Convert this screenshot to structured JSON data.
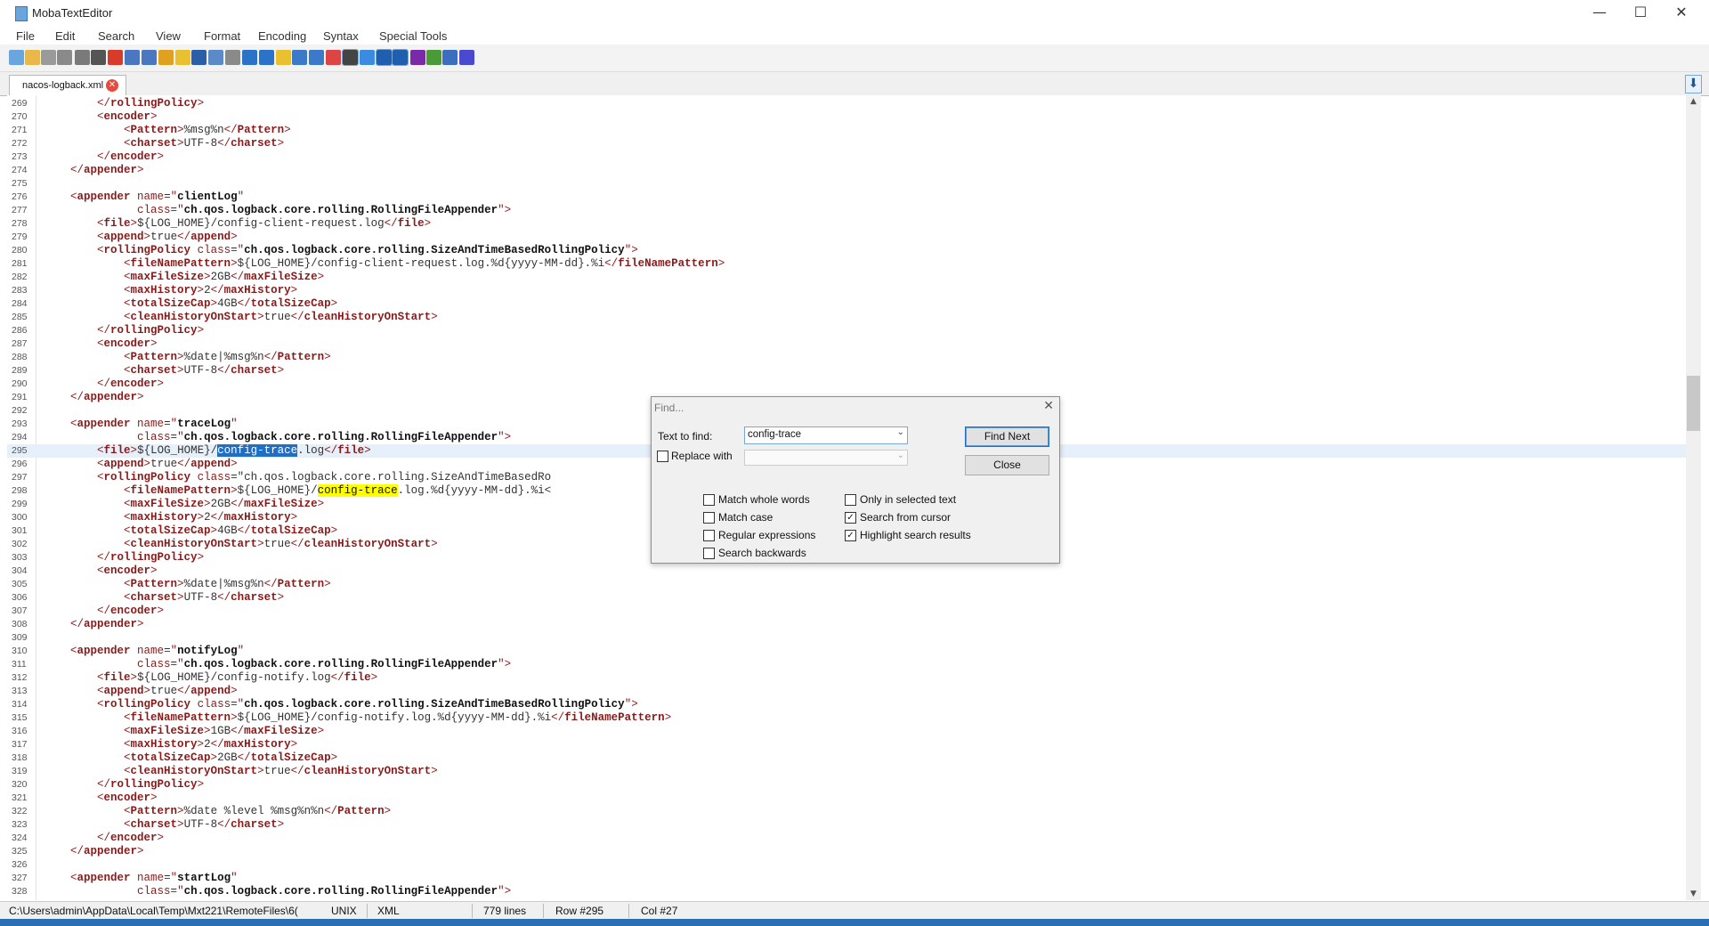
{
  "window": {
    "title": "MobaTextEditor",
    "minimize": "—",
    "maximize": "☐",
    "close": "✕"
  },
  "menu": [
    "File",
    "Edit",
    "Search",
    "View",
    "Format",
    "Encoding",
    "Syntax",
    "Special Tools"
  ],
  "toolbar_icons": [
    "new-file-icon",
    "open-folder-icon",
    "reload-icon",
    "save-icon",
    "save-all-icon",
    "print-icon",
    "close-file-icon",
    "indent-icon",
    "unindent-icon",
    "bookmark-icon",
    "favorite-icon",
    "cut-icon",
    "copy-icon",
    "paste-icon",
    "find-icon",
    "find-replace-icon",
    "mark-icon",
    "window-icon",
    "split-icon",
    "windows-icon",
    "linux-icon",
    "apple-icon",
    "undo-icon",
    "column-icon",
    "pilcrow-icon",
    "highlighter-icon",
    "settings-icon",
    "close-all-icon"
  ],
  "tab": {
    "label": "nacos-logback.xml",
    "close": "✕",
    "nav": "⬇"
  },
  "colors": {
    "tag": "#8a1a1a",
    "selection": "#1f6fc8",
    "highlight": "#ffff00",
    "current_line": "#e6f0fb"
  },
  "editor": {
    "current_line": 295,
    "lines": [
      {
        "n": "269",
        "t": "        </rollingPolicy>"
      },
      {
        "n": "270",
        "t": "        <encoder>"
      },
      {
        "n": "271",
        "t": "            <Pattern>%msg%n</Pattern>"
      },
      {
        "n": "272",
        "t": "            <charset>UTF-8</charset>"
      },
      {
        "n": "273",
        "t": "        </encoder>"
      },
      {
        "n": "274",
        "t": "    </appender>"
      },
      {
        "n": "275",
        "t": ""
      },
      {
        "n": "276",
        "t": "    <appender name=\"clientLog\""
      },
      {
        "n": "277",
        "t": "              class=\"ch.qos.logback.core.rolling.RollingFileAppender\">"
      },
      {
        "n": "278",
        "t": "        <file>${LOG_HOME}/config-client-request.log</file>"
      },
      {
        "n": "279",
        "t": "        <append>true</append>"
      },
      {
        "n": "280",
        "t": "        <rollingPolicy class=\"ch.qos.logback.core.rolling.SizeAndTimeBasedRollingPolicy\">"
      },
      {
        "n": "281",
        "t": "            <fileNamePattern>${LOG_HOME}/config-client-request.log.%d{yyyy-MM-dd}.%i</fileNamePattern>"
      },
      {
        "n": "282",
        "t": "            <maxFileSize>2GB</maxFileSize>"
      },
      {
        "n": "283",
        "t": "            <maxHistory>2</maxHistory>"
      },
      {
        "n": "284",
        "t": "            <totalSizeCap>4GB</totalSizeCap>"
      },
      {
        "n": "285",
        "t": "            <cleanHistoryOnStart>true</cleanHistoryOnStart>"
      },
      {
        "n": "286",
        "t": "        </rollingPolicy>"
      },
      {
        "n": "287",
        "t": "        <encoder>"
      },
      {
        "n": "288",
        "t": "            <Pattern>%date|%msg%n</Pattern>"
      },
      {
        "n": "289",
        "t": "            <charset>UTF-8</charset>"
      },
      {
        "n": "290",
        "t": "        </encoder>"
      },
      {
        "n": "291",
        "t": "    </appender>"
      },
      {
        "n": "292",
        "t": ""
      },
      {
        "n": "293",
        "t": "    <appender name=\"traceLog\""
      },
      {
        "n": "294",
        "t": "              class=\"ch.qos.logback.core.rolling.RollingFileAppender\">"
      },
      {
        "n": "295",
        "t": "        <file>${LOG_HOME}/config-trace.log</file>",
        "sel": "config-trace"
      },
      {
        "n": "296",
        "t": "        <append>true</append>"
      },
      {
        "n": "297",
        "t": "        <rollingPolicy class=\"ch.qos.logback.core.rolling.SizeAndTimeBasedRo"
      },
      {
        "n": "298",
        "t": "            <fileNamePattern>${LOG_HOME}/config-trace.log.%d{yyyy-MM-dd}.%i<",
        "hl": "config-trace"
      },
      {
        "n": "299",
        "t": "            <maxFileSize>2GB</maxFileSize>"
      },
      {
        "n": "300",
        "t": "            <maxHistory>2</maxHistory>"
      },
      {
        "n": "301",
        "t": "            <totalSizeCap>4GB</totalSizeCap>"
      },
      {
        "n": "302",
        "t": "            <cleanHistoryOnStart>true</cleanHistoryOnStart>"
      },
      {
        "n": "303",
        "t": "        </rollingPolicy>"
      },
      {
        "n": "304",
        "t": "        <encoder>"
      },
      {
        "n": "305",
        "t": "            <Pattern>%date|%msg%n</Pattern>"
      },
      {
        "n": "306",
        "t": "            <charset>UTF-8</charset>"
      },
      {
        "n": "307",
        "t": "        </encoder>"
      },
      {
        "n": "308",
        "t": "    </appender>"
      },
      {
        "n": "309",
        "t": ""
      },
      {
        "n": "310",
        "t": "    <appender name=\"notifyLog\""
      },
      {
        "n": "311",
        "t": "              class=\"ch.qos.logback.core.rolling.RollingFileAppender\">"
      },
      {
        "n": "312",
        "t": "        <file>${LOG_HOME}/config-notify.log</file>"
      },
      {
        "n": "313",
        "t": "        <append>true</append>"
      },
      {
        "n": "314",
        "t": "        <rollingPolicy class=\"ch.qos.logback.core.rolling.SizeAndTimeBasedRollingPolicy\">"
      },
      {
        "n": "315",
        "t": "            <fileNamePattern>${LOG_HOME}/config-notify.log.%d{yyyy-MM-dd}.%i</fileNamePattern>"
      },
      {
        "n": "316",
        "t": "            <maxFileSize>1GB</maxFileSize>"
      },
      {
        "n": "317",
        "t": "            <maxHistory>2</maxHistory>"
      },
      {
        "n": "318",
        "t": "            <totalSizeCap>2GB</totalSizeCap>"
      },
      {
        "n": "319",
        "t": "            <cleanHistoryOnStart>true</cleanHistoryOnStart>"
      },
      {
        "n": "320",
        "t": "        </rollingPolicy>"
      },
      {
        "n": "321",
        "t": "        <encoder>"
      },
      {
        "n": "322",
        "t": "            <Pattern>%date %level %msg%n%n</Pattern>"
      },
      {
        "n": "323",
        "t": "            <charset>UTF-8</charset>"
      },
      {
        "n": "324",
        "t": "        </encoder>"
      },
      {
        "n": "325",
        "t": "    </appender>"
      },
      {
        "n": "326",
        "t": ""
      },
      {
        "n": "327",
        "t": "    <appender name=\"startLog\""
      },
      {
        "n": "328",
        "t": "              class=\"ch.qos.logback.core.rolling.RollingFileAppender\">"
      }
    ]
  },
  "status": {
    "path": "C:\\Users\\admin\\AppData\\Local\\Temp\\Mxt221\\RemoteFiles\\6(",
    "eol": "UNIX",
    "syntax": "XML",
    "lines": "779 lines",
    "row": "Row #295",
    "col": "Col #27"
  },
  "find_dialog": {
    "title": "Find...",
    "text_to_find_label": "Text to find:",
    "text_to_find_value": "config-trace",
    "replace_with_label": "Replace with",
    "replace_checked": false,
    "find_next": "Find Next",
    "close": "Close",
    "options_left": [
      {
        "label": "Match whole words",
        "checked": false
      },
      {
        "label": "Match case",
        "checked": false
      },
      {
        "label": "Regular expressions",
        "checked": false
      },
      {
        "label": "Search backwards",
        "checked": false
      }
    ],
    "options_right": [
      {
        "label": "Only in selected text",
        "checked": false
      },
      {
        "label": "Search from cursor",
        "checked": true
      },
      {
        "label": "Highlight search results",
        "checked": true
      }
    ]
  }
}
